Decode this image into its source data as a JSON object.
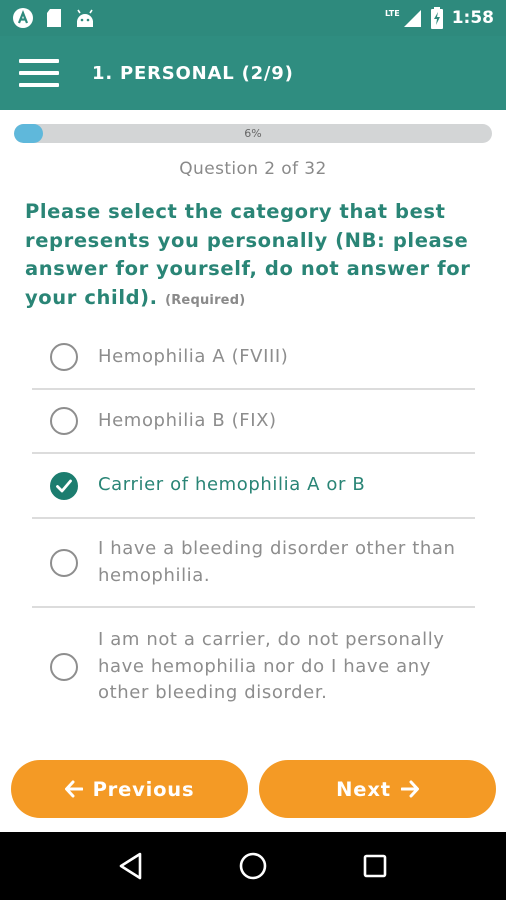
{
  "status_bar": {
    "time": "1:58",
    "network": "LTE",
    "colors": {
      "background": "#2e8a7d"
    },
    "icons": [
      "app-a-icon",
      "sd-card-icon",
      "android-icon",
      "signal-icon",
      "battery-charging-icon"
    ]
  },
  "app_bar": {
    "title": "1. PERSONAL (2/9)",
    "menu_icon": "hamburger-menu-icon"
  },
  "progress": {
    "percent_label": "6%",
    "value": 0.06,
    "colors": {
      "fill": "#5fb8db",
      "track": "#d3d5d6"
    }
  },
  "question": {
    "counter": "Question 2 of 32",
    "text": "Please select the category that best represents you personally (NB: please answer for yourself, do not answer for your child).",
    "required_label": "(Required)",
    "options": [
      {
        "label": "Hemophilia A (FVIII)",
        "selected": false
      },
      {
        "label": "Hemophilia B (FIX)",
        "selected": false
      },
      {
        "label": "Carrier of hemophilia A or B",
        "selected": true
      },
      {
        "label": "I have a bleeding disorder other than hemophilia.",
        "selected": false
      },
      {
        "label": "I am not a carrier, do not personally have hemophilia nor do I have any other bleeding disorder.",
        "selected": false
      }
    ]
  },
  "navigation": {
    "previous_label": "Previous",
    "next_label": "Next",
    "colors": {
      "button": "#f49a25"
    }
  },
  "system_nav": {
    "icons": [
      "back-triangle-icon",
      "home-circle-icon",
      "recents-square-icon"
    ]
  }
}
